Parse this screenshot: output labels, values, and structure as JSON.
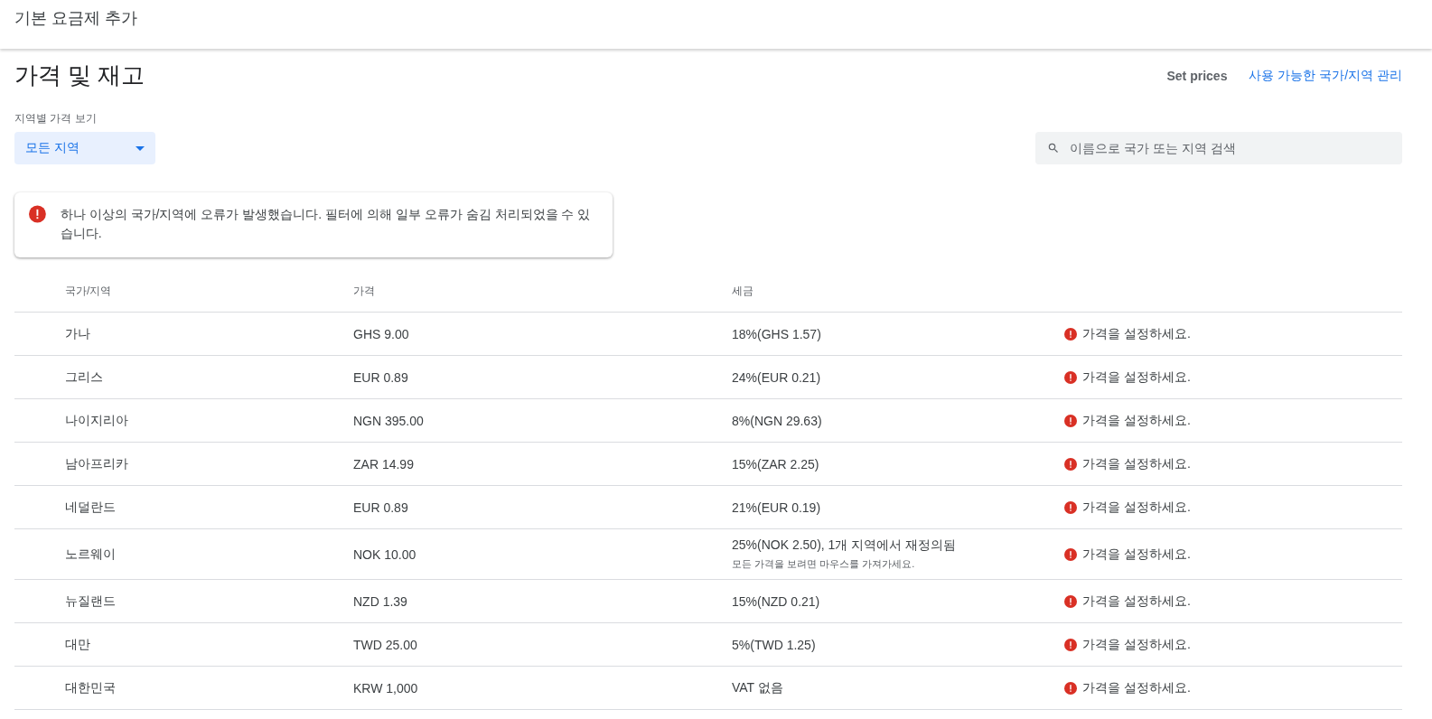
{
  "header": {
    "title": "기본 요금제 추가"
  },
  "section": {
    "title": "가격 및 재고",
    "actions": [
      {
        "kind": "text",
        "label": "Set prices"
      },
      {
        "kind": "link",
        "label": "사용 가능한 국가/지역 관리"
      }
    ]
  },
  "filter": {
    "label": "지역별 가격 보기",
    "value": "모든 지역"
  },
  "search": {
    "placeholder": "이름으로 국가 또는 지역 검색"
  },
  "alert": {
    "message": "하나 이상의 국가/지역에 오류가 발생했습니다. 필터에 의해 일부 오류가 숨김 처리되었을 수 있습니다."
  },
  "table": {
    "columns": [
      "국가/지역",
      "가격",
      "세금"
    ],
    "rows": [
      {
        "country": "가나",
        "price": "GHS 9.00",
        "tax": "18%(GHS 1.57)",
        "error": "가격을 설정하세요."
      },
      {
        "country": "그리스",
        "price": "EUR 0.89",
        "tax": "24%(EUR 0.21)",
        "error": "가격을 설정하세요."
      },
      {
        "country": "나이지리아",
        "price": "NGN 395.00",
        "tax": "8%(NGN 29.63)",
        "error": "가격을 설정하세요."
      },
      {
        "country": "남아프리카",
        "price": "ZAR 14.99",
        "tax": "15%(ZAR 2.25)",
        "error": "가격을 설정하세요."
      },
      {
        "country": "네덜란드",
        "price": "EUR 0.89",
        "tax": "21%(EUR 0.19)",
        "error": "가격을 설정하세요."
      },
      {
        "country": "노르웨이",
        "price": "NOK 10.00",
        "tax": "25%(NOK 2.50), 1개 지역에서 재정의됨",
        "tax_note": "모든 가격을 보려면 마우스를 가져가세요.",
        "error": "가격을 설정하세요."
      },
      {
        "country": "뉴질랜드",
        "price": "NZD 1.39",
        "tax": "15%(NZD 0.21)",
        "error": "가격을 설정하세요."
      },
      {
        "country": "대만",
        "price": "TWD 25.00",
        "tax": "5%(TWD 1.25)",
        "error": "가격을 설정하세요."
      },
      {
        "country": "대한민국",
        "price": "KRW 1,000",
        "tax": "VAT 없음",
        "error": "가격을 설정하세요."
      }
    ]
  }
}
